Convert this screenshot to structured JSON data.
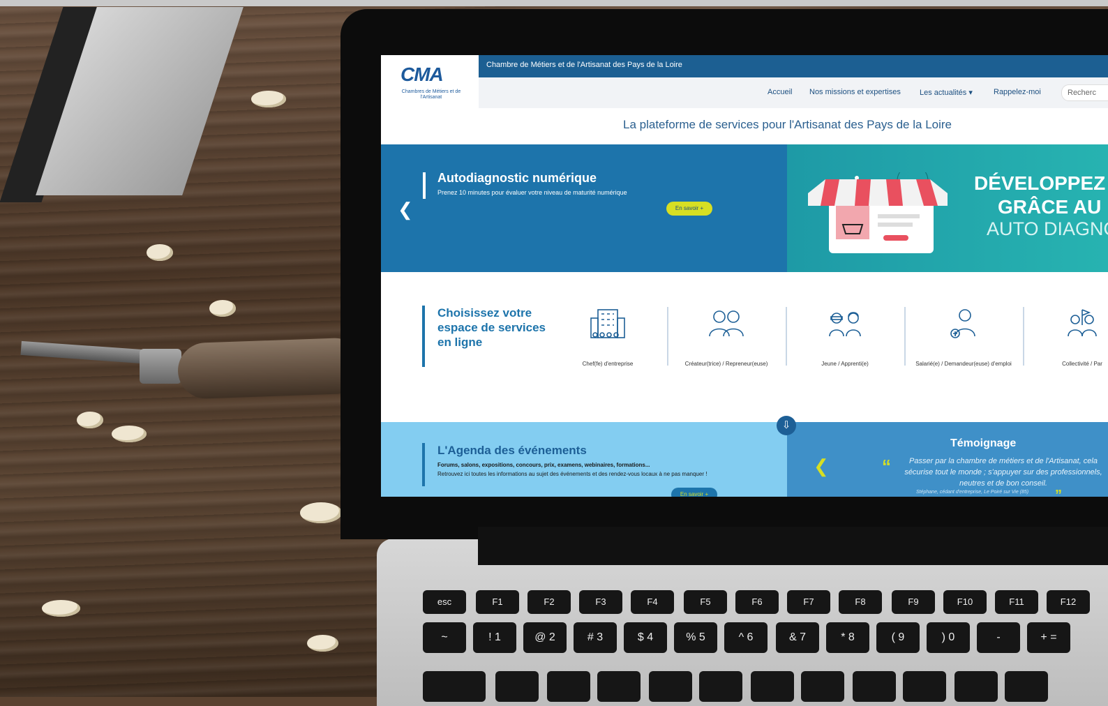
{
  "site": {
    "org_name": "Chambre de Métiers et de l'Artisanat des Pays de la Loire",
    "logo_text": "CMA",
    "logo_subtitle": "Chambres de Métiers et de l'Artisanat",
    "headline": "La plateforme de services pour l'Artisanat des Pays de la Loire"
  },
  "nav": {
    "items": [
      {
        "label": "Accueil"
      },
      {
        "label": "Nos missions et expertises"
      },
      {
        "label": "Les actualités ▾"
      },
      {
        "label": "Rappelez-moi"
      }
    ],
    "search_placeholder": "Recherc"
  },
  "slider": {
    "title": "Autodiagnostic numérique",
    "subtitle": "Prenez 10 minutes pour évaluer votre niveau de maturité numérique",
    "button": "En savoir +",
    "promo_line1": "DÉVELOPPEZ VOTI",
    "promo_line2": "GRÂCE AU NUM",
    "promo_line3": "AUTO DIAGNOSTI"
  },
  "espace": {
    "title": "Choisissez votre espace de services en ligne",
    "items": [
      {
        "label": "Chef(fe) d'entreprise",
        "icon": "building-icon"
      },
      {
        "label": "Créateur(trice) / Repreneur(euse)",
        "icon": "two-people-icon"
      },
      {
        "label": "Jeune / Apprenti(e)",
        "icon": "young-people-icon"
      },
      {
        "label": "Salarié(e) / Demandeur(euse) d'emploi",
        "icon": "employee-icon"
      },
      {
        "label": "Collectivité / Par",
        "icon": "community-icon"
      }
    ]
  },
  "agenda": {
    "title": "L'Agenda des événements",
    "bold_line": "Forums, salons, expositions, concours, prix, examens, webinaires, formations...",
    "text": "Retrouvez ici toutes les informations au sujet des événements et des rendez-vous locaux à ne pas manquer !",
    "button": "En savoir +"
  },
  "temoignage": {
    "title": "Témoignage",
    "quote_open": "“",
    "quote_close": "”",
    "text": "Passer par la chambre de métiers et de l'Artisanat, cela sécurise tout le monde ; s'appuyer sur des professionnels, neutres et de bon conseil.",
    "author": "Stéphane, cédant d'entreprise, Le Poiré sur Vie (85)"
  },
  "keyboard": {
    "fn_row": [
      "esc",
      "F1",
      "F2",
      "F3",
      "F4",
      "F5",
      "F6",
      "F7",
      "F8",
      "F9",
      "F10",
      "F11",
      "F12"
    ],
    "num_row": [
      "~",
      "! 1",
      "@ 2",
      "# 3",
      "$ 4",
      "% 5",
      "^ 6",
      "& 7",
      "* 8",
      "( 9",
      ") 0",
      "-",
      "+ ="
    ]
  },
  "colors": {
    "brand_blue": "#1d74ab",
    "accent_lime": "#d7df23",
    "light_blue": "#83cdf1",
    "teal": "#27b3b1"
  }
}
